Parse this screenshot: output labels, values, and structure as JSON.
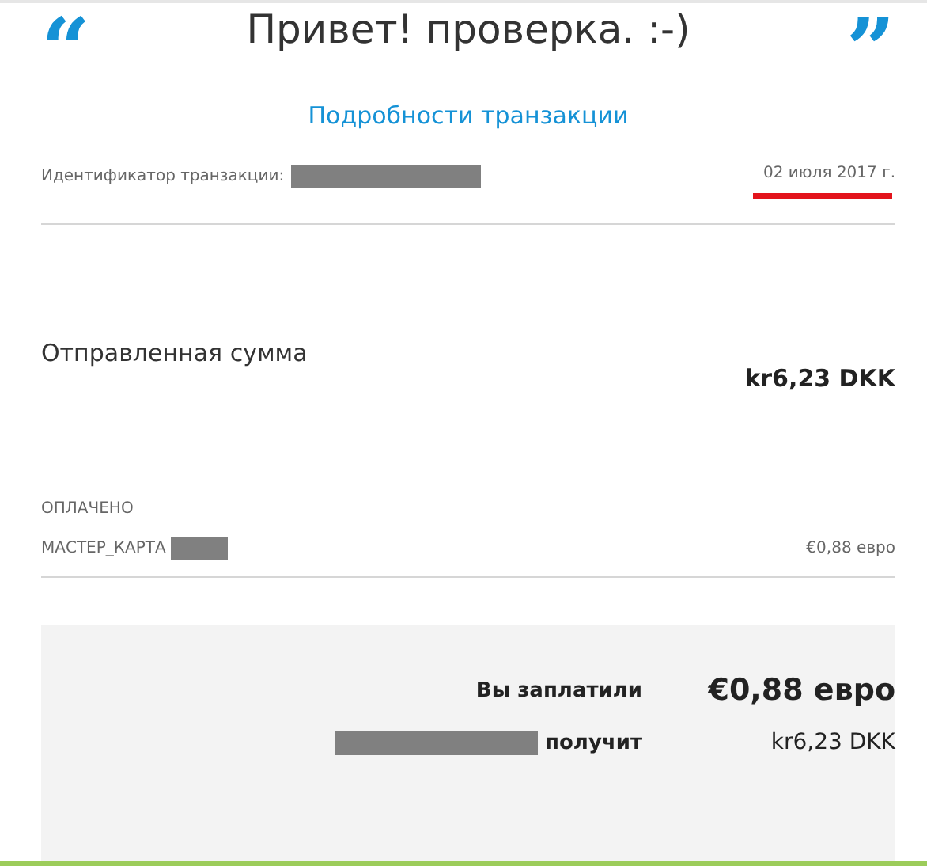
{
  "header": {
    "open_quote": "“",
    "greeting": "Привет! проверка. :-)",
    "close_quote": "”"
  },
  "section_title": "Подробности транзакции",
  "transaction": {
    "id_label": "Идентификатор транзакции:",
    "id_redacted": true,
    "date": "02 июля 2017 г.",
    "date_underlined": true
  },
  "sent": {
    "label": "Отправленная сумма",
    "amount": "kr6,23 DKK"
  },
  "payment": {
    "heading": "ОПЛАЧЕНО",
    "method": "МАСТЕР_КАРТА",
    "method_redacted": true,
    "amount": "€0,88 евро"
  },
  "summary": [
    {
      "kind": "paid",
      "label": "Вы заплатили",
      "redacted": false,
      "value": "€0,88 евро"
    },
    {
      "kind": "received",
      "label": "получит",
      "redacted": true,
      "value": "kr6,23 DKK"
    }
  ]
}
